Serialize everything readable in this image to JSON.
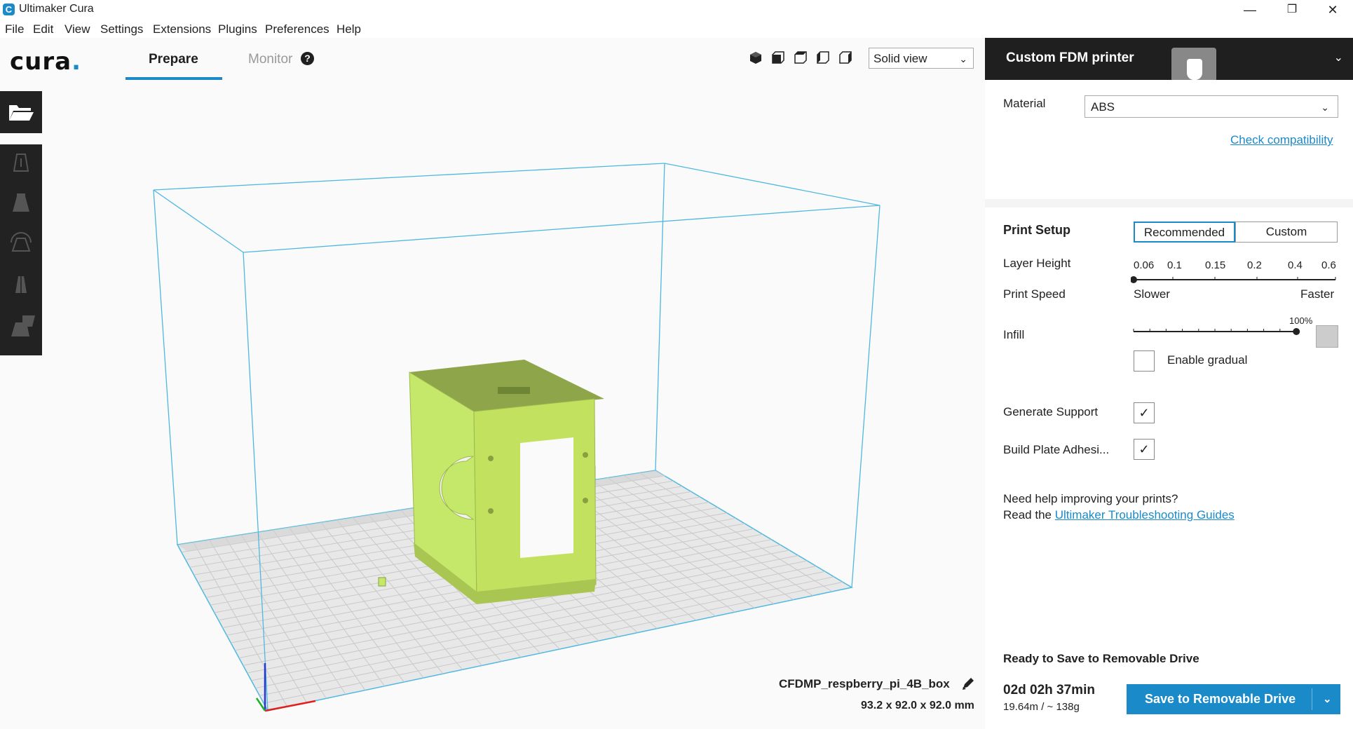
{
  "window": {
    "title": "Ultimaker Cura",
    "app_icon": "cura-app-icon",
    "minimize": "—",
    "restore": "❐",
    "close": "✕"
  },
  "menu": [
    "File",
    "Edit",
    "View",
    "Settings",
    "Extensions",
    "Plugins",
    "Preferences",
    "Help"
  ],
  "header": {
    "logo": "cura",
    "tabs": {
      "prepare": "Prepare",
      "monitor": "Monitor"
    },
    "help_glyph": "?",
    "view_select": "Solid view",
    "camera_icons": [
      "3d-view-icon",
      "front-view-icon",
      "top-view-icon",
      "left-view-icon",
      "right-view-icon"
    ]
  },
  "toolbar": {
    "open": "folder-open-icon",
    "tools": [
      "move-icon",
      "scale-icon",
      "rotate-icon",
      "mirror-icon",
      "support-blocker-icon"
    ]
  },
  "object": {
    "name": "CFDMP_respberry_pi_4B_box",
    "dimensions": "93.2 x 92.0 x 92.0 mm"
  },
  "panel": {
    "printer": "Custom FDM printer",
    "material_label": "Material",
    "material_value": "ABS",
    "check_compat": "Check compatibility",
    "print_setup": "Print Setup",
    "mode_recommended": "Recommended",
    "mode_custom": "Custom",
    "layer_height_label": "Layer Height",
    "layer_heights": [
      "0.06",
      "0.1",
      "0.15",
      "0.2",
      "0.4",
      "0.6"
    ],
    "layer_height_selected": "0.06",
    "print_speed_label": "Print Speed",
    "speed_slower": "Slower",
    "speed_faster": "Faster",
    "infill_label": "Infill",
    "infill_value": "100%",
    "infill_fraction": 0.9,
    "gradual_label": "Enable gradual",
    "gradual_checked": false,
    "support_label": "Generate Support",
    "support_checked": true,
    "adhesion_label": "Build Plate Adhesi...",
    "adhesion_checked": true,
    "help_line1": "Need help improving your prints?",
    "help_line2": "Read the ",
    "help_link": "Ultimaker Troubleshooting Guides",
    "ready": "Ready to Save to Removable Drive",
    "time": "02d 02h 37min",
    "material_use": "19.64m / ~ 138g",
    "save_button": "Save to Removable Drive"
  },
  "colors": {
    "accent": "#1a8ac9",
    "dark": "#1f1f1f",
    "model": "#c6e86a",
    "buildvolume": "#4db8e0"
  }
}
